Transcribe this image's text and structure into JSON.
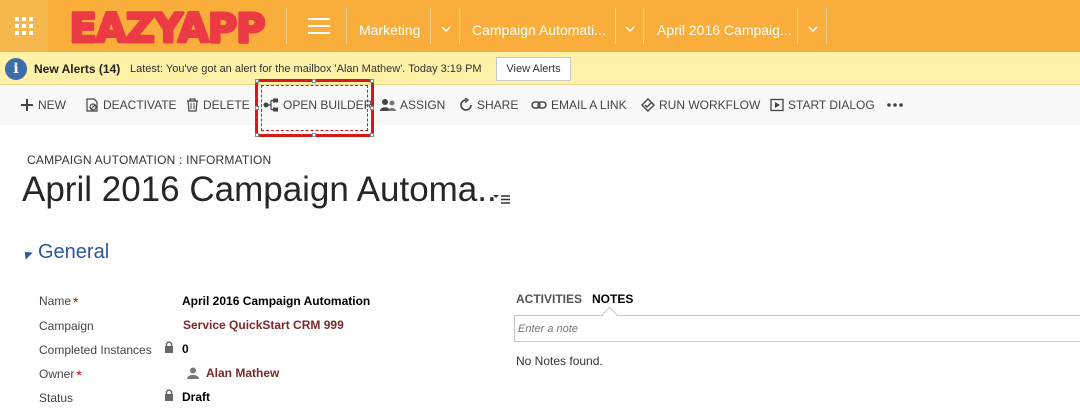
{
  "topnav": {
    "logo_text": "EAZYAPP",
    "breadcrumb": [
      {
        "label": "Marketing"
      },
      {
        "label": "Campaign Automati..."
      },
      {
        "label": "April 2016 Campaig..."
      }
    ]
  },
  "alerts": {
    "title": "New Alerts (14)",
    "latest": "Latest: You've got an alert for the mailbox 'Alan Mathew'. Today 3:19 PM",
    "view_button": "View Alerts"
  },
  "commands": [
    {
      "label": "NEW",
      "icon": "plus-icon"
    },
    {
      "label": "DEACTIVATE",
      "icon": "deactivate-icon"
    },
    {
      "label": "DELETE",
      "icon": "trash-icon"
    },
    {
      "label": "OPEN BUILDER",
      "icon": "builder-icon"
    },
    {
      "label": "ASSIGN",
      "icon": "assign-icon"
    },
    {
      "label": "SHARE",
      "icon": "share-icon"
    },
    {
      "label": "EMAIL A LINK",
      "icon": "link-icon"
    },
    {
      "label": "RUN WORKFLOW",
      "icon": "workflow-icon"
    },
    {
      "label": "START DIALOG",
      "icon": "dialog-icon"
    }
  ],
  "record": {
    "entity_label": "CAMPAIGN AUTOMATION : INFORMATION",
    "title": "April 2016 Campaign Automa.."
  },
  "section": {
    "title": "General"
  },
  "fields": {
    "name": {
      "label": "Name",
      "value": "April 2016 Campaign Automation",
      "required": "*"
    },
    "campaign": {
      "label": "Campaign",
      "value": "Service QuickStart CRM 999"
    },
    "completed": {
      "label": "Completed Instances",
      "value": "0"
    },
    "owner": {
      "label": "Owner",
      "value": "Alan Mathew",
      "required": "*"
    },
    "status": {
      "label": "Status",
      "value": "Draft"
    }
  },
  "notes_panel": {
    "tab_activities": "ACTIVITIES",
    "tab_notes": "NOTES",
    "input_placeholder": "Enter a note",
    "empty_text": "No Notes found."
  },
  "colors": {
    "nav_bg": "#f9ae3b",
    "alert_bg": "#fdf2a8",
    "section_blue": "#2b579a",
    "link_red": "#7a2929",
    "highlight_red": "#d51a1a"
  }
}
